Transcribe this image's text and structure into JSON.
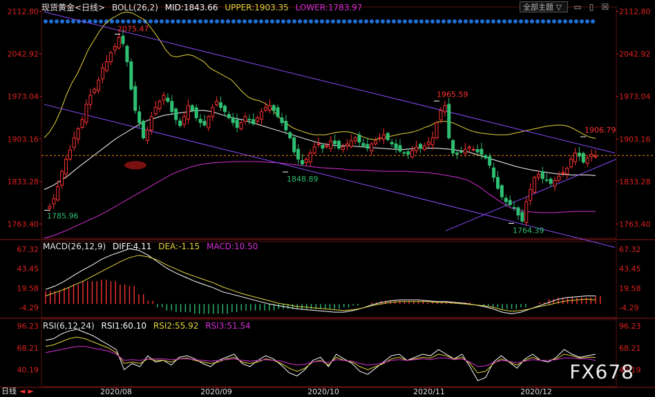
{
  "header": {
    "symbol": "现货黄金<日线>",
    "boll_label": "BOLL(26,2)",
    "mid": "MID:1843.66",
    "upper": "UPPER:1903.35",
    "lower": "LOWER:1783.97",
    "theme_select": "全部主题"
  },
  "macd_header": {
    "name": "MACD(26,12,9)",
    "diff": "DIFF:4.11",
    "dea": "DEA:-1.15",
    "macd": "MACD:10.50"
  },
  "rsi_header": {
    "name": "RSI(6,12,24)",
    "rsi1": "RSI1:60.10",
    "rsi2": "RSI2:55.92",
    "rsi3": "RSI3:51.54"
  },
  "footer": {
    "period": "日线",
    "watermark": "FX678"
  },
  "colors": {
    "up": "#ff3232",
    "down": "#2fbf73",
    "mid": "#ffffff",
    "upper": "#e6d43c",
    "lower": "#d42ed4",
    "channel": "#8a4bff",
    "dash": "#ff8c00",
    "axis": "#e02020"
  },
  "chart_data": [
    {
      "type": "candlestick",
      "ylim": [
        1740,
        2118
      ],
      "y_ticks": [
        "2112.80",
        "2042.92",
        "1973.04",
        "1903.16",
        "1833.28",
        "1763.40"
      ],
      "x_labels": [
        "2020/08",
        "2020/09",
        "2020/10",
        "2020/11",
        "2020/12"
      ],
      "annotations": [
        "2075.47",
        "1965.59",
        "1906.79",
        "1785.96",
        "1848.89",
        "1764.39"
      ],
      "close_path": [
        1789,
        1792,
        1805,
        1825,
        1850,
        1870,
        1885,
        1905,
        1920,
        1935,
        1960,
        1975,
        1985,
        2000,
        2020,
        2030,
        2045,
        2055,
        2070,
        2060,
        2030,
        1985,
        1950,
        1930,
        1905,
        1918,
        1940,
        1955,
        1965,
        1975,
        1965,
        1948,
        1935,
        1925,
        1940,
        1958,
        1950,
        1938,
        1930,
        1926,
        1940,
        1955,
        1965,
        1955,
        1948,
        1938,
        1930,
        1922,
        1930,
        1940,
        1935,
        1928,
        1938,
        1948,
        1955,
        1958,
        1950,
        1940,
        1930,
        1918,
        1905,
        1882,
        1870,
        1862,
        1870,
        1880,
        1890,
        1895,
        1888,
        1892,
        1900,
        1895,
        1888,
        1890,
        1895,
        1900,
        1905,
        1898,
        1892,
        1888,
        1895,
        1900,
        1905,
        1910,
        1902,
        1895,
        1888,
        1883,
        1880,
        1878,
        1884,
        1890,
        1888,
        1892,
        1898,
        1905,
        1930,
        1950,
        1958,
        1905,
        1880,
        1878,
        1882,
        1886,
        1890,
        1886,
        1882,
        1878,
        1872,
        1860,
        1840,
        1822,
        1808,
        1800,
        1795,
        1790,
        1778,
        1768,
        1800,
        1820,
        1840,
        1845,
        1838,
        1835,
        1830,
        1835,
        1842,
        1848,
        1855,
        1870,
        1880,
        1875,
        1865,
        1872,
        1878,
        1875
      ],
      "band_upper": [
        1905,
        1915,
        1930,
        1950,
        1975,
        1995,
        2010,
        2030,
        2050,
        2065,
        2080,
        2092,
        2100,
        2105,
        2110,
        2112,
        2110,
        2105,
        2100,
        2090,
        2078,
        2065,
        2050,
        2040,
        2038,
        2040,
        2042,
        2040,
        2035,
        2030,
        2020,
        2015,
        2010,
        2005,
        2000,
        1990,
        1980,
        1972,
        1968,
        1966,
        1962,
        1955,
        1945,
        1935,
        1928,
        1922,
        1918,
        1915,
        1912,
        1910,
        1910,
        1910,
        1912,
        1914,
        1915,
        1915,
        1913,
        1910,
        1906,
        1903,
        1902,
        1904,
        1906,
        1908,
        1910,
        1912,
        1913,
        1915,
        1918,
        1922,
        1925,
        1930,
        1932,
        1932,
        1930,
        1926,
        1922,
        1918,
        1915,
        1913,
        1912,
        1911,
        1910,
        1910,
        1910,
        1912,
        1914,
        1916,
        1918,
        1920,
        1922,
        1924,
        1925,
        1926,
        1926,
        1924,
        1920,
        1915,
        1910,
        1906,
        1904
      ],
      "band_mid": [
        1820,
        1826,
        1834,
        1843,
        1854,
        1864,
        1874,
        1884,
        1894,
        1904,
        1912,
        1920,
        1928,
        1934,
        1938,
        1942,
        1944,
        1946,
        1948,
        1950,
        1950,
        1948,
        1944,
        1940,
        1937,
        1934,
        1930,
        1926,
        1922,
        1918,
        1914,
        1910,
        1906,
        1902,
        1898,
        1895,
        1893,
        1892,
        1892,
        1891,
        1890,
        1889,
        1888,
        1887,
        1886,
        1886,
        1887,
        1888,
        1888,
        1888,
        1887,
        1886,
        1884,
        1882,
        1878,
        1874,
        1870,
        1866,
        1862,
        1858,
        1855,
        1852,
        1850,
        1848,
        1846,
        1845,
        1844,
        1844,
        1844,
        1843
      ],
      "band_lower": [
        1740,
        1745,
        1752,
        1760,
        1768,
        1776,
        1785,
        1795,
        1805,
        1815,
        1825,
        1835,
        1845,
        1852,
        1858,
        1862,
        1864,
        1865,
        1866,
        1866,
        1866,
        1865,
        1864,
        1862,
        1860,
        1858,
        1856,
        1855,
        1854,
        1852,
        1852,
        1851,
        1850,
        1850,
        1850,
        1849,
        1848,
        1846,
        1843,
        1840,
        1835,
        1825,
        1812,
        1800,
        1790,
        1785,
        1783,
        1782,
        1782,
        1783,
        1784,
        1784,
        1784
      ]
    },
    {
      "type": "bar",
      "name": "MACD",
      "ylim": [
        -15,
        75
      ],
      "y_ticks": [
        "67.32",
        "43.45",
        "19.58",
        "-4.29"
      ],
      "diff": [
        18,
        22,
        28,
        35,
        42,
        48,
        55,
        60,
        64,
        68,
        66,
        60,
        52,
        44,
        38,
        33,
        28,
        24,
        20,
        15,
        12,
        9,
        6,
        3,
        0,
        -2,
        -4,
        -6,
        -7,
        -8,
        -9,
        -10,
        -10,
        -8,
        -5,
        -1,
        2,
        4,
        5,
        5,
        5,
        4,
        3,
        3,
        2,
        1,
        -1,
        -3,
        -6,
        -10,
        -12,
        -10,
        -6,
        -2,
        2,
        6,
        8,
        9,
        10,
        10
      ],
      "dea": [
        10,
        14,
        18,
        23,
        28,
        34,
        40,
        46,
        52,
        57,
        60,
        58,
        54,
        48,
        43,
        38,
        34,
        30,
        26,
        21,
        17,
        13,
        10,
        7,
        4,
        1,
        -1,
        -3,
        -4,
        -5,
        -6,
        -7,
        -8,
        -7,
        -5,
        -2,
        0,
        2,
        3,
        3,
        3,
        3,
        2,
        2,
        1,
        0,
        -1,
        -2,
        -4,
        -7,
        -9,
        -8,
        -6,
        -3,
        -1,
        2,
        4,
        5,
        6,
        5
      ]
    },
    {
      "type": "line",
      "name": "RSI",
      "ylim": [
        20,
        100
      ],
      "y_ticks": [
        "96.23",
        "68.21",
        "40.19"
      ],
      "series": [
        {
          "name": "RSI1",
          "values": [
            78,
            80,
            86,
            90,
            92,
            88,
            84,
            78,
            72,
            66,
            40,
            48,
            44,
            58,
            50,
            52,
            46,
            56,
            58,
            54,
            48,
            44,
            52,
            56,
            60,
            48,
            44,
            52,
            58,
            54,
            46,
            36,
            32,
            40,
            52,
            56,
            44,
            60,
            54,
            48,
            38,
            34,
            42,
            50,
            58,
            60,
            52,
            56,
            60,
            58,
            66,
            60,
            54,
            60,
            44,
            26,
            30,
            50,
            58,
            50,
            42,
            54,
            60,
            52,
            50,
            56,
            66,
            60,
            56,
            58,
            60
          ]
        },
        {
          "name": "RSI2",
          "values": [
            70,
            72,
            76,
            80,
            82,
            80,
            76,
            72,
            68,
            62,
            48,
            50,
            48,
            54,
            52,
            52,
            50,
            54,
            55,
            52,
            50,
            48,
            50,
            54,
            56,
            50,
            48,
            50,
            54,
            52,
            48,
            42,
            38,
            42,
            50,
            52,
            46,
            56,
            52,
            50,
            44,
            40,
            44,
            48,
            54,
            56,
            52,
            54,
            56,
            55,
            60,
            58,
            54,
            56,
            48,
            36,
            38,
            48,
            54,
            50,
            46,
            52,
            56,
            52,
            52,
            54,
            60,
            58,
            55,
            56,
            56
          ]
        },
        {
          "name": "RSI3",
          "values": [
            62,
            64,
            66,
            68,
            70,
            70,
            68,
            66,
            64,
            60,
            52,
            53,
            52,
            54,
            54,
            54,
            53,
            54,
            54,
            53,
            52,
            51,
            52,
            53,
            54,
            52,
            51,
            52,
            53,
            52,
            51,
            48,
            46,
            47,
            50,
            51,
            49,
            53,
            52,
            51,
            48,
            46,
            47,
            49,
            52,
            53,
            52,
            53,
            54,
            53,
            55,
            55,
            53,
            54,
            50,
            44,
            45,
            49,
            52,
            51,
            49,
            51,
            53,
            52,
            52,
            53,
            55,
            55,
            54,
            54,
            52
          ]
        }
      ]
    }
  ]
}
